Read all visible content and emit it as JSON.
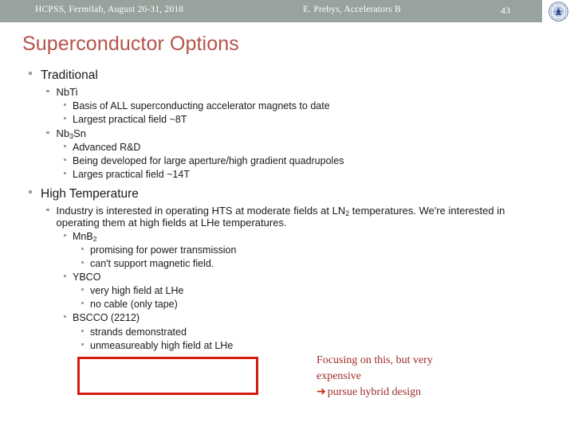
{
  "header": {
    "left_text": "HCPSS, Fermilab, August 20-31, 2018",
    "center_text": "E. Prebys, Accelerators B",
    "page_number": "43",
    "logo_name": "fermilab-seal-logo",
    "bar_color": "#97a39c"
  },
  "title": {
    "text": "Superconductor Options",
    "color": "#b4534a"
  },
  "outline": {
    "traditional": {
      "label": "Traditional",
      "nbti": {
        "label_prefix": "Nb",
        "label_sub": "",
        "label_suffix": "Ti",
        "points": [
          "Basis of ALL superconducting accelerator magnets to date",
          "Largest practical field ~8T"
        ]
      },
      "nb3sn": {
        "label_prefix": "Nb",
        "label_sub": "3",
        "label_suffix": "Sn",
        "points": [
          "Advanced R&D",
          "Being developed for large aperture/high gradient quadrupoles",
          "Larges practical field ~14T"
        ]
      }
    },
    "high_temperature": {
      "label": "High Temperature",
      "intro_part1": "Industry is interested in operating HTS at moderate fields at LN",
      "intro_sub": "2",
      "intro_part2": " temperatures.  We're interested in operating them at high fields at LHe temperatures.",
      "mnb2": {
        "label_prefix": "MnB",
        "label_sub": "2",
        "label_suffix": "",
        "points": [
          "promising for power transmission",
          "can't support magnetic field."
        ]
      },
      "ybco": {
        "label": "YBCO",
        "points": [
          "very high field at LHe",
          "no cable (only tape)"
        ]
      },
      "bscco": {
        "label": "BSCCO (2212)",
        "points": [
          "strands demonstrated",
          "unmeasureably high field at LHe"
        ]
      }
    }
  },
  "annotation": {
    "line1": "Focusing on this, but very",
    "line2": "expensive",
    "arrow": "➔",
    "line3": "pursue hybrid design",
    "color": "#9e2b25"
  },
  "highlight_box": {
    "color": "#d61b0d"
  }
}
